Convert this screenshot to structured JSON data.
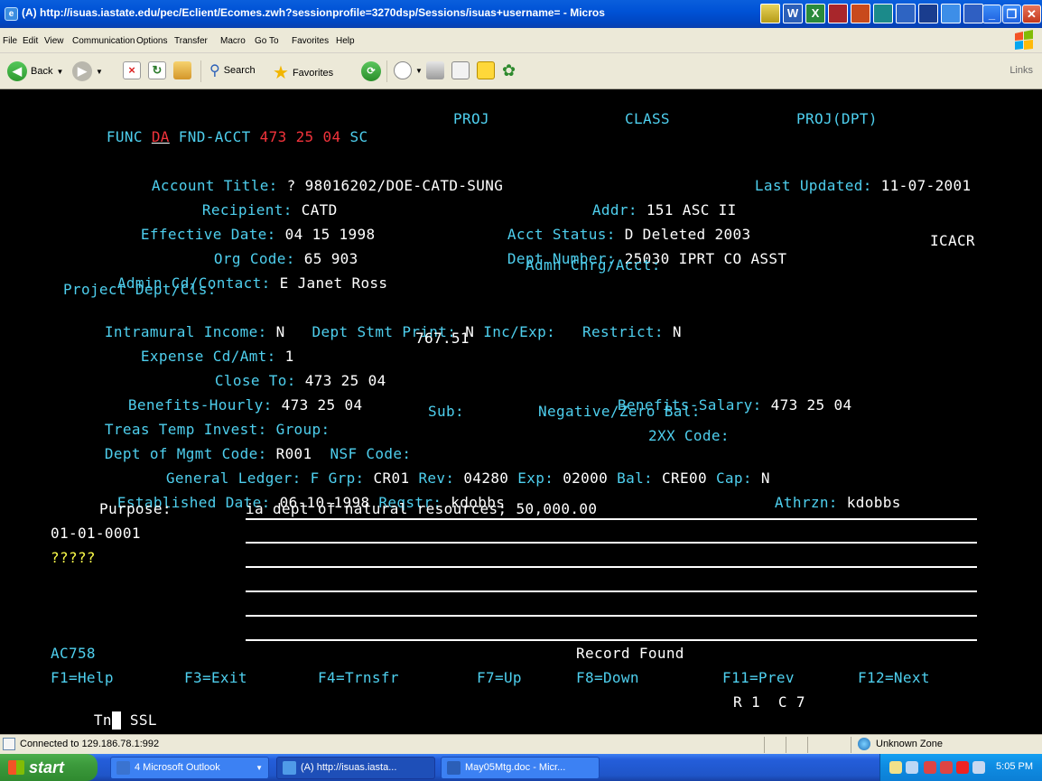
{
  "window": {
    "title": "(A) http://isuas.iastate.edu/pec/Eclient/Ecomes.zwh?sessionprofile=3270dsp/Sessions/isuas+username= - Micros"
  },
  "menu": [
    "File",
    "Edit",
    "View",
    "Communication",
    "Options",
    "Transfer",
    "Macro",
    "Go To",
    "Favorites",
    "Help"
  ],
  "toolbar": {
    "back": "Back",
    "search": "Search",
    "favorites": "Favorites",
    "links": "Links"
  },
  "terminal": {
    "func_label": "FUNC",
    "func_value": "DA",
    "fnd_acct_label": "FND-ACCT",
    "fnd_acct_value": "473 25 04",
    "sc_label": "SC",
    "proj_label": "PROJ",
    "class_label": "CLASS",
    "projdpt_label": "PROJ(DPT)",
    "account_title_label": "Account Title:",
    "account_title_value": "? 98016202/DOE-CATD-SUNG",
    "last_updated_label": "Last Updated:",
    "last_updated_value": "11-07-2001",
    "recipient_label": "Recipient:",
    "recipient_value": "CATD",
    "addr_label": "Addr:",
    "addr_value": "151 ASC II",
    "effective_date_label": "Effective Date:",
    "effective_date_value": "04 15 1998",
    "acct_status_label": "Acct Status:",
    "acct_status_value": "D Deleted 2003",
    "org_code_label": "Org Code:",
    "org_code_value": "65 903",
    "dept_number_label": "Dept Number:",
    "dept_number_value": "25030 IPRT CO ASST",
    "icacr": "ICACR",
    "admin_label": "Admin Cd/Contact:",
    "admin_value": "E Janet Ross",
    "admn_chrg_label": "Admn Chrg/Acct:",
    "project_dept_label": "Project Dept/Cls:",
    "intramural_label": "Intramural Income:",
    "intramural_value": "N",
    "dept_stmt_label": "Dept Stmt Print:",
    "dept_stmt_value": "N",
    "inc_exp_label": "Inc/Exp:",
    "restrict_label": "Restrict:",
    "restrict_value": "N",
    "expense_label": "Expense Cd/Amt:",
    "expense_cd": "1",
    "expense_amt": "767.51",
    "close_to_label": "Close To:",
    "close_to_value": "473 25 04",
    "benefits_hourly_label": "Benefits-Hourly:",
    "benefits_hourly_value": "473 25 04",
    "benefits_salary_label": "Benefits-Salary:",
    "benefits_salary_value": "473 25 04",
    "treas_label": "Treas Temp Invest:",
    "group_label": "Group:",
    "sub_label": "Sub:",
    "neg_zero_label": "Negative/Zero Bal:",
    "dept_mgmt_label": "Dept of Mgmt Code:",
    "dept_mgmt_value": "R001",
    "nsf_label": "NSF Code:",
    "code2xx_label": "2XX Code:",
    "gl_label": "General Ledger:",
    "fgrp_label": "F Grp:",
    "fgrp_value": "CR01",
    "rev_label": "Rev:",
    "rev_value": "04280",
    "exp_label": "Exp:",
    "exp_value": "02000",
    "bal_label": "Bal:",
    "bal_value": "CRE00",
    "cap_label": "Cap:",
    "cap_value": "N",
    "established_label": "Established Date:",
    "established_value": "06-10-1998",
    "reqstr_label": "Reqstr:",
    "reqstr_value": "kdobbs",
    "athrzn_label": "Athrzn:",
    "athrzn_value": "kdobbs",
    "purpose_label": "Purpose:",
    "purpose_value": "ia dept of natural resources; 50,000.00",
    "date_value": "01-01-0001",
    "question_marks": "?????",
    "screen_id": "AC758",
    "record_status": "Record Found",
    "fkeys": [
      "F1=Help",
      "F3=Exit",
      "F4=Trnsfr",
      "F7=Up",
      "F8=Down",
      "F11=Prev",
      "F12=Next"
    ],
    "cmd_prefix": "Tn",
    "cmd_value": "SSL",
    "row_col": "R 1  C 7"
  },
  "statusbar": {
    "connected": "Connected to 129.186.78.1:992",
    "zone": "Unknown Zone"
  },
  "taskbar": {
    "start": "start",
    "buttons": [
      "4 Microsoft Outlook",
      "(A) http://isuas.iasta...",
      "May05Mtg.doc - Micr..."
    ],
    "clock": "5:05 PM"
  },
  "colors": {
    "label": "#4ecfee",
    "value": "#ffffff",
    "highlight": "#f2333b",
    "warning": "#ffff4a"
  }
}
